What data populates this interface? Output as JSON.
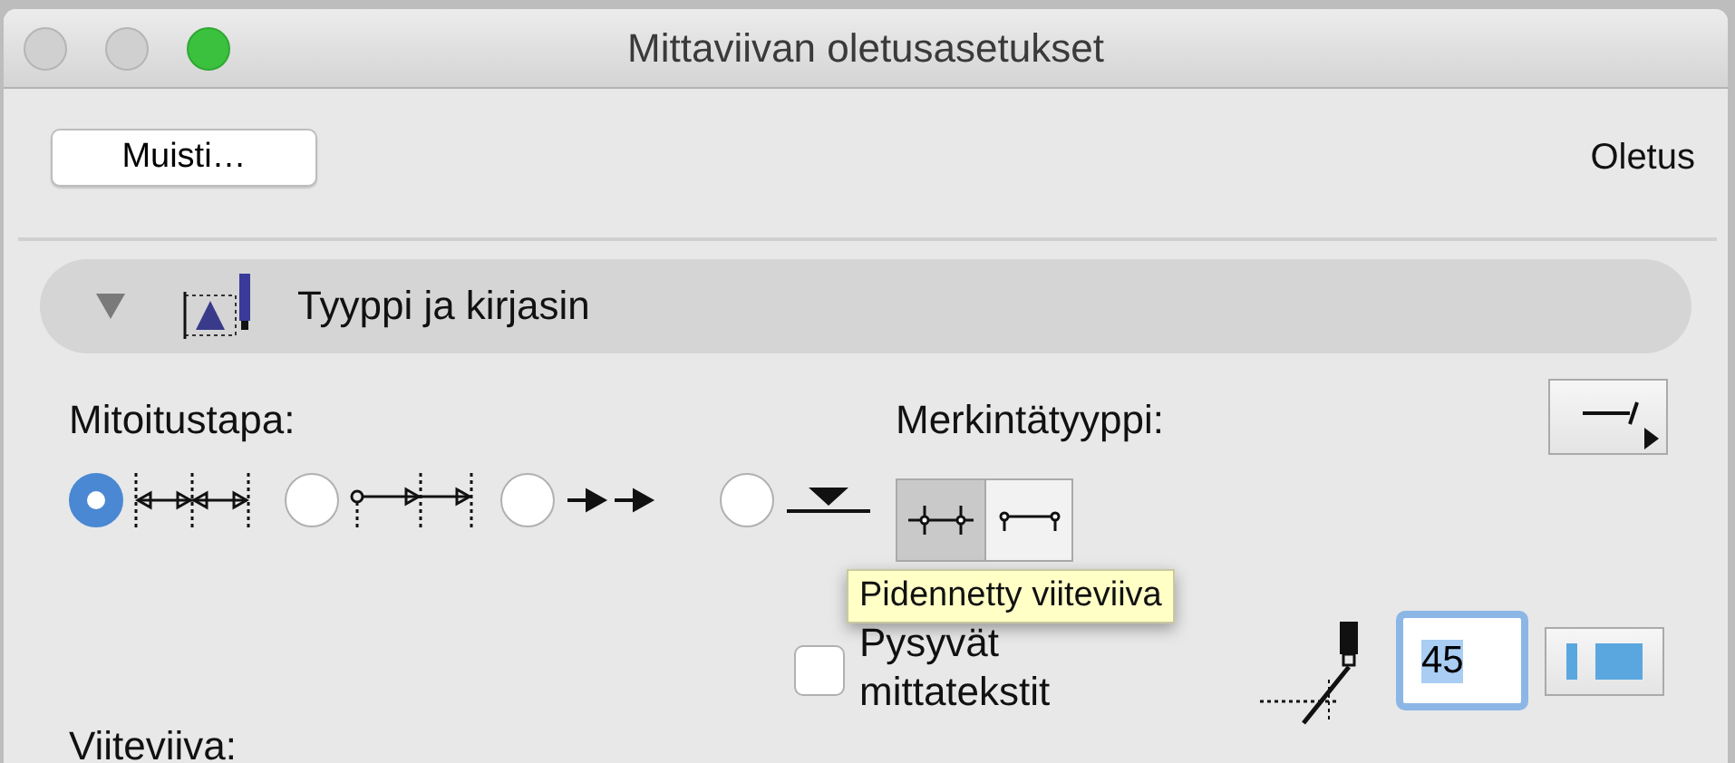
{
  "window": {
    "title": "Mittaviivan oletusasetukset"
  },
  "toolbar": {
    "memory_button": "Muisti…",
    "preset_label": "Oletus"
  },
  "section": {
    "title": "Tyyppi ja kirjasin",
    "expanded": true
  },
  "dimension_method": {
    "label": "Mitoitustapa:",
    "options": [
      {
        "kind": "linear",
        "selected": true
      },
      {
        "kind": "chained",
        "selected": false
      },
      {
        "kind": "arrows",
        "selected": false
      },
      {
        "kind": "elevation",
        "selected": false
      }
    ]
  },
  "marker_type": {
    "label": "Merkintätyyppi:",
    "segments": [
      {
        "kind": "extended",
        "selected": true
      },
      {
        "kind": "short",
        "selected": false
      }
    ]
  },
  "tooltip": "Pidennetty viiteviiva",
  "persistent_text": {
    "label": "Pysyvät mittatekstit",
    "checked": false
  },
  "angle_field": {
    "value": "45"
  },
  "witness_label": "Viiteviiva:"
}
